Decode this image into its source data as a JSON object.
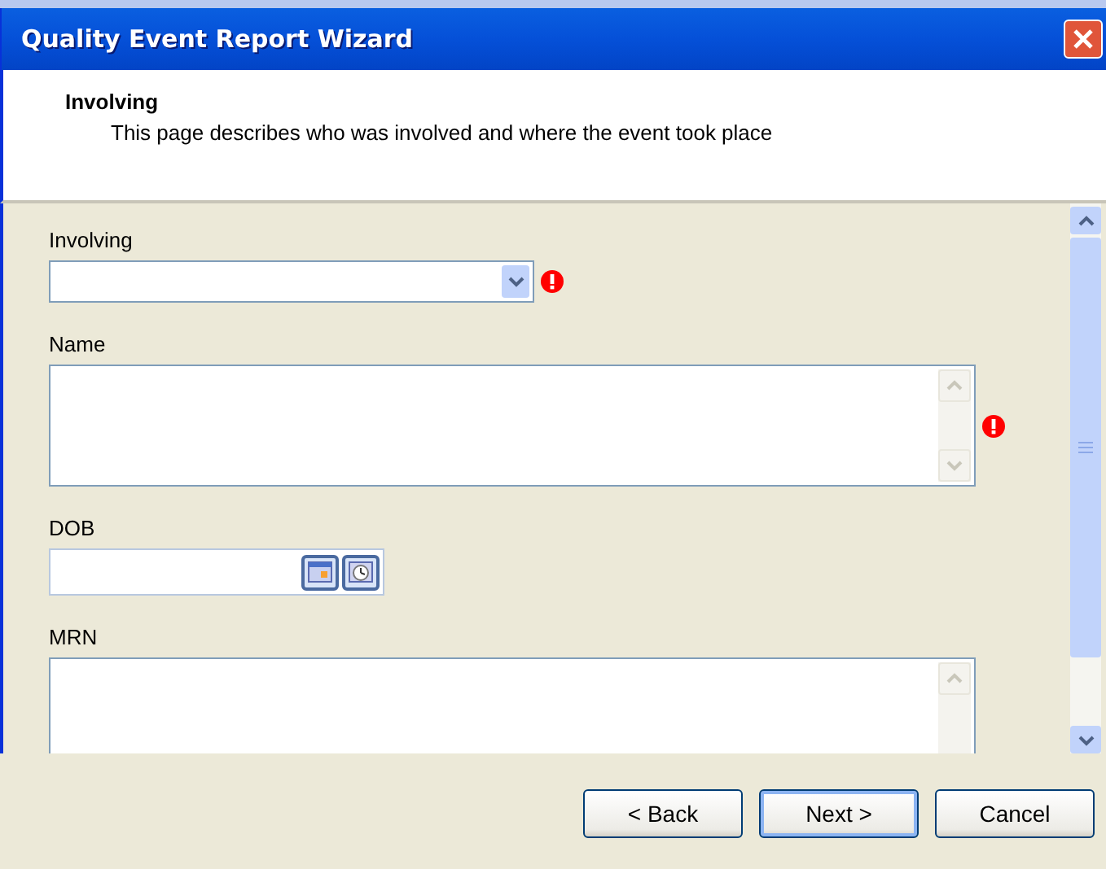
{
  "window": {
    "title": "Quality Event Report Wizard"
  },
  "header": {
    "title": "Involving",
    "description": "This page describes who was involved and where the event took place"
  },
  "fields": [
    {
      "kind": "combo",
      "label": "Involving",
      "error": true
    },
    {
      "kind": "memo",
      "label": "Name",
      "error": true
    },
    {
      "kind": "date",
      "label": "DOB",
      "error": false
    },
    {
      "kind": "memo",
      "label": "MRN",
      "error": false
    }
  ],
  "buttons": [
    {
      "label": "< Back",
      "default": false
    },
    {
      "label": "Next >",
      "default": true
    },
    {
      "label": "Cancel",
      "default": false
    }
  ]
}
